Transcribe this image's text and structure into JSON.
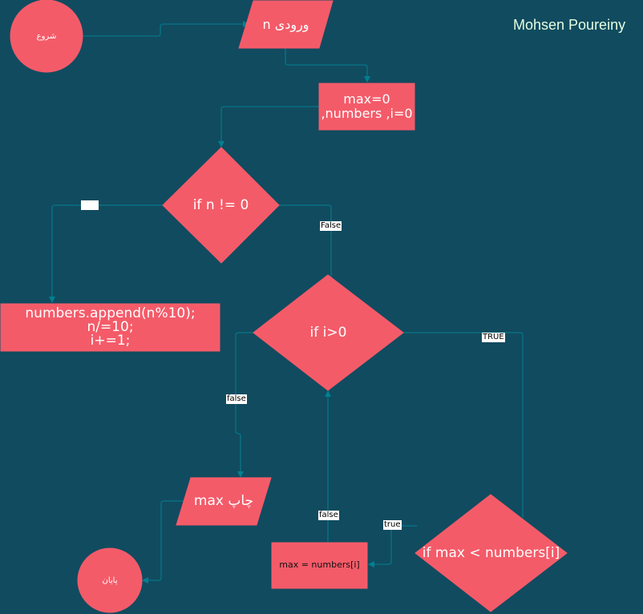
{
  "author": "Mohsen Poureiny",
  "colors": {
    "background": "#114B5F",
    "shape_fill": "#F45B69",
    "connector": "#028090",
    "text": "#FFFFFF"
  },
  "nodes": {
    "start": "شروع",
    "input": "n ورودی",
    "init": "max=0\n,numbers ,i=0",
    "cond_n": "if n != 0",
    "loop_body": "numbers.append(n%10);\nn/=10;\ni+=1;",
    "cond_i": "if i>0",
    "print": "max چاپ",
    "end": "پایان",
    "cond_max": "if max < numbers[i]",
    "assign_max": "max = numbers[i]"
  },
  "edges": {
    "cond_n_true": "",
    "cond_n_false": "False",
    "cond_i_true": "TRUE",
    "cond_i_false": "false",
    "cond_max_true": "true",
    "cond_max_false": "false"
  }
}
